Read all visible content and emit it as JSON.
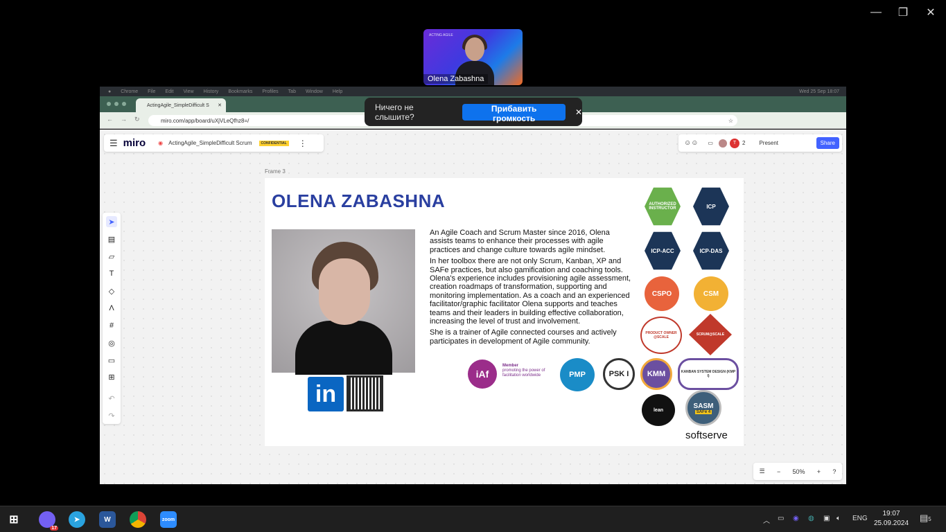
{
  "window": {
    "minimize": "—",
    "restore": "❐",
    "close": "✕"
  },
  "video": {
    "tag": "ACTING AGILE",
    "name": "Olena Zabashna"
  },
  "macbar": {
    "items": [
      "Chrome",
      "File",
      "Edit",
      "View",
      "History",
      "Bookmarks",
      "Profiles",
      "Tab",
      "Window",
      "Help"
    ],
    "clock": "Wed 25 Sep 18:07"
  },
  "chrome": {
    "tab_title": "ActingAgile_SimpleDifficult S",
    "url": "miro.com/app/board/uXjVLeQfhz8=/"
  },
  "toast": {
    "text": "Ничего не слышите?",
    "button": "Прибавить громкость",
    "close": "✕"
  },
  "miro": {
    "logo": "miro",
    "board_name": "ActingAgile_SimpleDifficult Scrum",
    "confidential": "CONFIDENTIAL",
    "user_initial": "T",
    "user_count": "2",
    "present": "Present",
    "share": "Share",
    "frame_label": "Frame 3",
    "zoom": "50%"
  },
  "slide": {
    "name": "OLENA ZABASHNA",
    "bio": [
      "An Agile Coach and Scrum Master since 2016, Olena assists teams to enhance their processes with agile practices and change culture towards agile mindset.",
      "In her toolbox there are not only Scrum, Kanban, XP and SAFe practices, but also gamification and coaching tools. Olena's experience includes provisioning agile assessment, creation roadmaps of transformation, supporting and monitoring implementation. As a coach and an experienced facilitator/graphic facilitator Olena supports and teaches teams and their leaders in building effective collaboration, increasing the level of trust and involvement.",
      "She is a trainer of Agile connected courses and actively participates in development of Agile community."
    ],
    "linkedin": "in",
    "badges": {
      "authorized": "AUTHORIZED INSTRUCTOR",
      "icp": "ICP",
      "icp_acc": "ICP-ACC",
      "icp_das": "ICP-DAS",
      "cspo": "CSPO",
      "csm": "CSM",
      "po_scale": "PRODUCT OWNER @SCALE",
      "sm_scale": "SCRUM@SCALE",
      "iaf": "iAf",
      "iaf_member": "Member",
      "iaf_text": "promoting the power of facilitation worldwide",
      "pmp": "PMP",
      "psk": "PSK I",
      "kmm": "KMM",
      "kmp": "KANBAN SYSTEM DESIGN (KMP I)",
      "lean": "lean",
      "sasm": "SASM",
      "safe": "SAFe 4"
    },
    "softserve": "softserve"
  },
  "taskbar": {
    "viber_badge": "17",
    "lang": "ENG",
    "time": "19:07",
    "date": "25.09.2024",
    "notif": "5"
  }
}
